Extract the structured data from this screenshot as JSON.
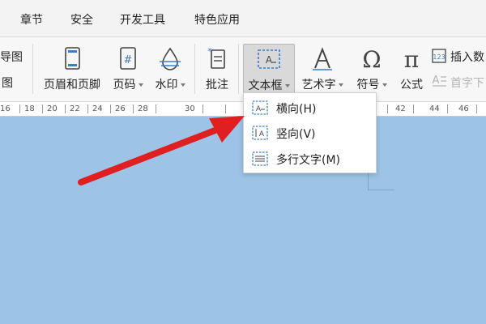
{
  "menubar": {
    "items": [
      "章节",
      "安全",
      "开发工具",
      "特色应用"
    ]
  },
  "ribbon": {
    "left_partial_top": "导图",
    "left_partial_bottom": "图",
    "buttons": {
      "header_footer": "页眉和页脚",
      "page_number": "页码",
      "watermark": "水印",
      "comment": "批注",
      "textbox": "文本框",
      "wordart": "艺术字",
      "symbol": "符号",
      "formula": "公式",
      "insert_number": "插入数",
      "dropcap": "首字下"
    }
  },
  "ruler": {
    "labels": [
      "16",
      "18",
      "20",
      "22",
      "24",
      "26",
      "28",
      "30",
      "42",
      "44",
      "46"
    ]
  },
  "textbox_menu": {
    "items": [
      {
        "label": "横向(H)",
        "icon": "horizontal-textbox-icon"
      },
      {
        "label": "竖向(V)",
        "icon": "vertical-textbox-icon"
      },
      {
        "label": "多行文字(M)",
        "icon": "multiline-textbox-icon"
      }
    ]
  },
  "colors": {
    "document_bg": "#9dc3e6",
    "arrow": "#e02020",
    "icon_blue": "#3c7fc4"
  }
}
